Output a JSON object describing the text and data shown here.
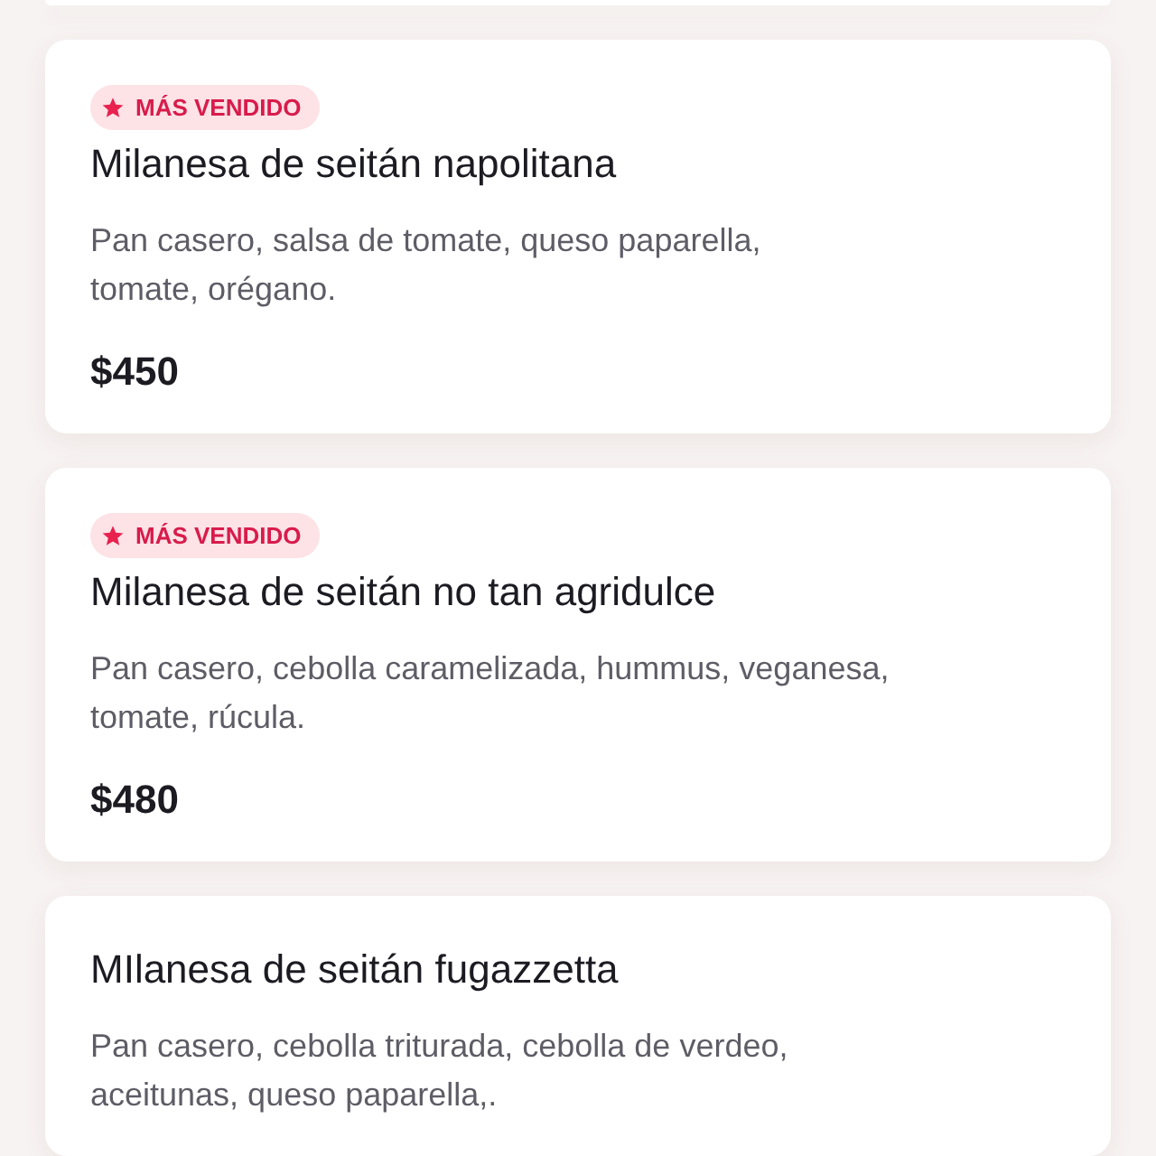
{
  "items": [
    {
      "best_seller": true,
      "badge_label": "MÁS VENDIDO",
      "title": "Milanesa de seitán napolitana",
      "description_lines": [
        "Pan casero, salsa de tomate, queso paparella,",
        "tomate, orégano."
      ],
      "price": "$450"
    },
    {
      "best_seller": true,
      "badge_label": "MÁS VENDIDO",
      "title": "Milanesa de seitán no tan agridulce",
      "description_lines": [
        "Pan casero, cebolla caramelizada, hummus, veganesa,",
        "tomate, rúcula."
      ],
      "price": "$480"
    },
    {
      "best_seller": false,
      "title": "MIlanesa de seitán fugazzetta",
      "description_lines": [
        "Pan casero, cebolla triturada, cebolla de verdeo,",
        "aceitunas, queso paparella,."
      ]
    }
  ]
}
